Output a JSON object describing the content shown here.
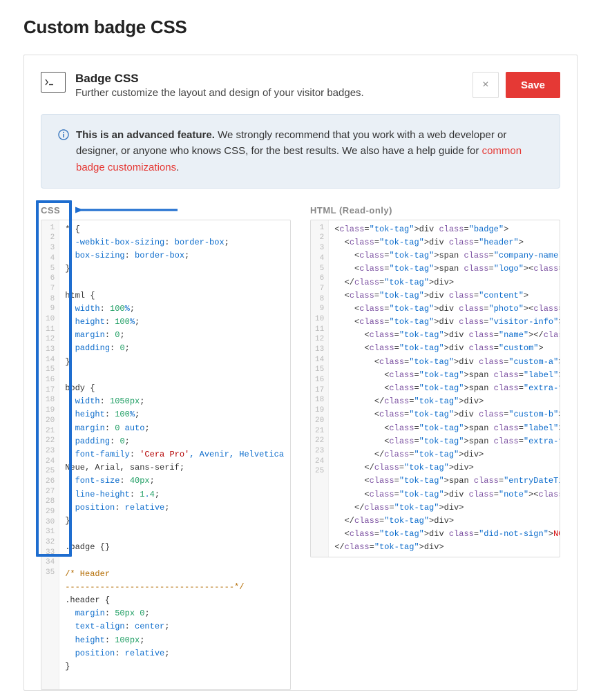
{
  "page": {
    "title": "Custom badge CSS"
  },
  "head": {
    "title": "Badge CSS",
    "desc": "Further customize the layout and design of your visitor badges.",
    "close_symbol": "×",
    "save_label": "Save"
  },
  "banner": {
    "bold": "This is an advanced feature.",
    "text_before_link": " We strongly recommend that you work with a web developer or designer, or anyone who knows CSS, for the best results. We also have a help guide for ",
    "link_text": "common badge customizations",
    "text_after_link": "."
  },
  "editors": {
    "css_label": "CSS",
    "html_label": "HTML (Read-only)"
  },
  "chart_data": {
    "type": "table",
    "css_lines": [
      "* {",
      "  -webkit-box-sizing: border-box;",
      "  box-sizing: border-box;",
      "}",
      "",
      "html {",
      "  width: 100%;",
      "  height: 100%;",
      "  margin: 0;",
      "  padding: 0;",
      "}",
      "",
      "body {",
      "  width: 1050px;",
      "  height: 100%;",
      "  margin: 0 auto;",
      "  padding: 0;",
      "  font-family: 'Cera Pro', Avenir, Helvetica Neue, Arial, sans-serif;",
      "  font-size: 40px;",
      "  line-height: 1.4;",
      "  position: relative;",
      "}",
      "",
      ".badge {}",
      "",
      "/* Header",
      "----------------------------------*/",
      ".header {",
      "  margin: 50px 0;",
      "  text-align: center;",
      "  height: 100px;",
      "  position: relative;",
      "}",
      ""
    ],
    "html_lines": [
      "<div class=\"badge\">",
      "  <div class=\"header\">",
      "    <span class=\"company-name\"></span>",
      "    <span class=\"logo\"><img src=\"\"></span>",
      "  </div>",
      "  <div class=\"content\">",
      "    <div class=\"photo\"><img src=\"\"></div>",
      "    <div class=\"visitor-info\">",
      "      <div class=\"name\"></div>",
      "      <div class=\"custom\">",
      "        <div class=\"custom-a\">",
      "          <span class=\"label\"></span>",
      "          <span class=\"extra-field\"></span>",
      "        </div>",
      "        <div class=\"custom-b\">",
      "          <span class=\"label\"></span>",
      "          <span class=\"extra-field\"></span>",
      "        </div>",
      "      </div>",
      "      <span class=\"entryDateTime\"></span>",
      "      <div class=\"note\"><span></span></div>",
      "    </div>",
      "  </div>",
      "  <div class=\"did-not-sign\">NO<br>NDA</div>",
      "</div>"
    ]
  }
}
